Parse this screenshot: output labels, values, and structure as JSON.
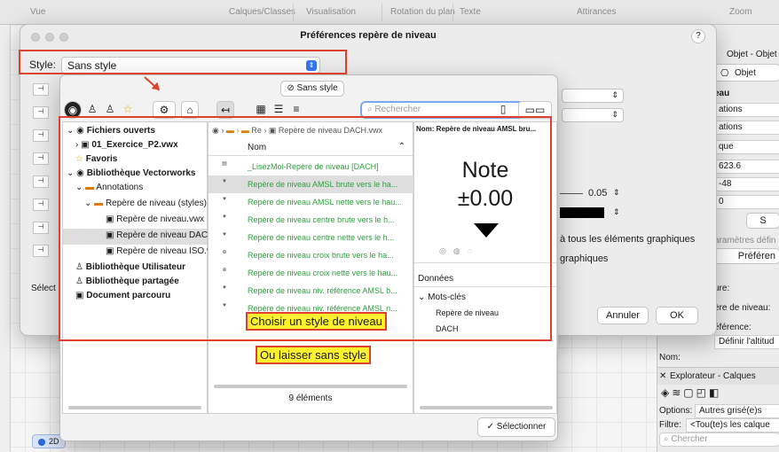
{
  "topbar": {
    "vue": "Vue",
    "calques": "Calques/Classes",
    "visualisation": "Visualisation",
    "rotation": "Rotation du plan",
    "texte": "Texte",
    "attirances": "Attirances",
    "zoom": "Zoom"
  },
  "dialog": {
    "title": "Préférences repère de niveau",
    "help": "?",
    "style_label": "Style:",
    "style_value": "Sans style",
    "selection_btn": "Sélect",
    "annuler": "Annuler",
    "ok": "OK",
    "row_a": "0.05",
    "row_b_text": "à tous les éléments graphiques",
    "row_c_text": "graphiques"
  },
  "picker": {
    "sans_style_btn": "Sans style",
    "search_placeholder": "Rechercher",
    "tree": [
      {
        "label": "Fichiers ouverts",
        "bold": true
      },
      {
        "label": "01_Exercice_P2.vwx",
        "bold": true
      },
      {
        "label": "Favoris",
        "bold": true
      },
      {
        "label": "Bibliothèque Vectorworks",
        "bold": true
      },
      {
        "label": "Annotations"
      },
      {
        "label": "Repère de niveau (styles)"
      },
      {
        "label": "Repère de niveau.vwx"
      },
      {
        "label": "Repère de niveau DACH"
      },
      {
        "label": "Repère de niveau ISO.v"
      },
      {
        "label": "Bibliothèque Utilisateur",
        "bold": true
      },
      {
        "label": "Bibliothèque partagée",
        "bold": true
      },
      {
        "label": "Document parcouru",
        "bold": true
      }
    ],
    "breadcrumb": {
      "item1": "Re",
      "item2": "Repère de niveau DACH.vwx"
    },
    "list_header": "Nom",
    "items": [
      "_LisezMoi-Repère de niveau [DACH]",
      "Repère de niveau AMSL brute vers le ha...",
      "Repère de niveau AMSL nette vers le hau...",
      "Repère de niveau centre brute vers le h...",
      "Repère de niveau centre nette vers le h...",
      "Repère de niveau croix brute vers le ha...",
      "Repère de niveau croix nette vers le hau...",
      "Repère de niveau niv. référence AMSL b...",
      "Repère de niveau niv. référence AMSL n..."
    ],
    "count": "9 éléments",
    "preview": {
      "name": "Nom: Repère de niveau AMSL bru...",
      "note": "Note",
      "value": "±0.00"
    },
    "data": {
      "header": "Données",
      "mots_cles": "Mots-clés",
      "kw1": "Repère de niveau",
      "kw2": "DACH"
    },
    "select_btn": "Sélectionner"
  },
  "annotations": {
    "callout1": "Choisir un style de niveau",
    "callout2": "Ou laisser sans style"
  },
  "right_panel": {
    "tab1": "Objet - Objet",
    "tab2": "Objet",
    "l1": "eau",
    "f1": "ations",
    "f2": "ations",
    "f3": "que",
    "v1": "623.6",
    "v2": "-48",
    "v3": "0",
    "s_btn": "S",
    "param": "aramètres défin",
    "pref": "Préféren",
    "l2": "ure:",
    "l3": "ère de niveau:",
    "l4": "éférence:",
    "def": "Définir l'altitud",
    "nom": "Nom:",
    "explorer": "Explorateur - Calques",
    "options_label": "Options:",
    "options_val": "Autres grisé(e)s",
    "filtre_label": "Filtre:",
    "filtre_val": "<Tou(te)s les calque",
    "search": "Chercher"
  },
  "view_badge": "2D"
}
